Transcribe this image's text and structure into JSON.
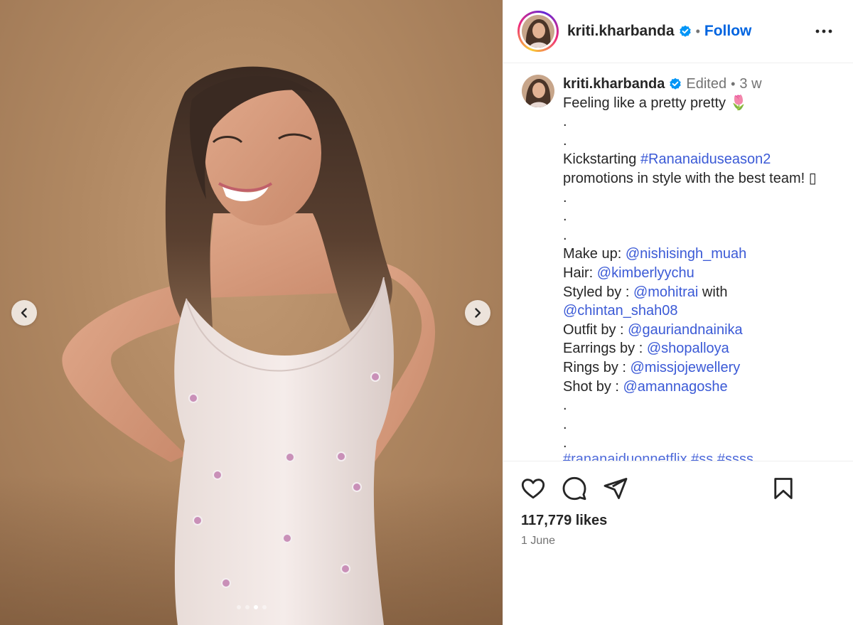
{
  "post": {
    "username": "kriti.kharbanda",
    "follow_label": "Follow",
    "separator": "•",
    "edited_label": "Edited",
    "time_ago": "3 w",
    "likes": "117,779 likes",
    "date": "1 June"
  },
  "carousel": {
    "slide_count": 4,
    "active_index": 2
  },
  "caption": {
    "line1": "Feeling like a pretty pretty 🌷",
    "dot": ".",
    "kick_prefix": "Kickstarting ",
    "kick_tag": "#Rananaiduseason2",
    "kick_line2": "promotions in style with the best team! ▯",
    "credits": [
      {
        "prefix": "Make up: ",
        "handle": "@nishisingh_muah"
      },
      {
        "prefix": "Hair: ",
        "handle": "@kimberlyychu"
      },
      {
        "prefix": "Styled by : ",
        "handle": "@mohitrai",
        "suffix": " with"
      },
      {
        "prefix": "",
        "handle": "@chintan_shah08"
      },
      {
        "prefix": "Outfit by : ",
        "handle": "@gauriandnainika"
      },
      {
        "prefix": "Earrings by : ",
        "handle": "@shopalloya"
      },
      {
        "prefix": "Rings by : ",
        "handle": "@missjojewellery"
      },
      {
        "prefix": "Shot by : ",
        "handle": "@amannagoshe"
      }
    ],
    "hashtags_cut": "#rananaiduonnetflix #ss #ssss"
  },
  "colors": {
    "link": "#3b5ad6",
    "follow": "#0064e0",
    "muted": "#737373",
    "verified": "#0095f6"
  }
}
